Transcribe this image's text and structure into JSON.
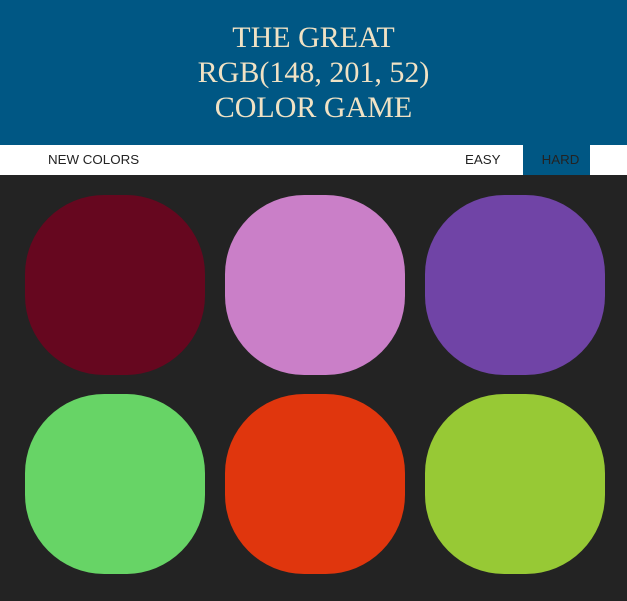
{
  "header": {
    "line1": "THE GREAT",
    "line2": "RGB(148, 201, 52)",
    "line3": "COLOR GAME"
  },
  "controls": {
    "new_colors_label": "NEW COLORS",
    "easy_label": "EASY",
    "hard_label": "HARD",
    "selected_mode": "hard"
  },
  "colors": {
    "header_bg": "#005784",
    "header_text": "#f0e2c4",
    "board_bg": "#232323"
  },
  "squares": [
    {
      "color": "#66071f"
    },
    {
      "color": "#ca7fc8"
    },
    {
      "color": "#7044a6"
    },
    {
      "color": "#67d466"
    },
    {
      "color": "#e0360d"
    },
    {
      "color": "#97c935"
    }
  ]
}
